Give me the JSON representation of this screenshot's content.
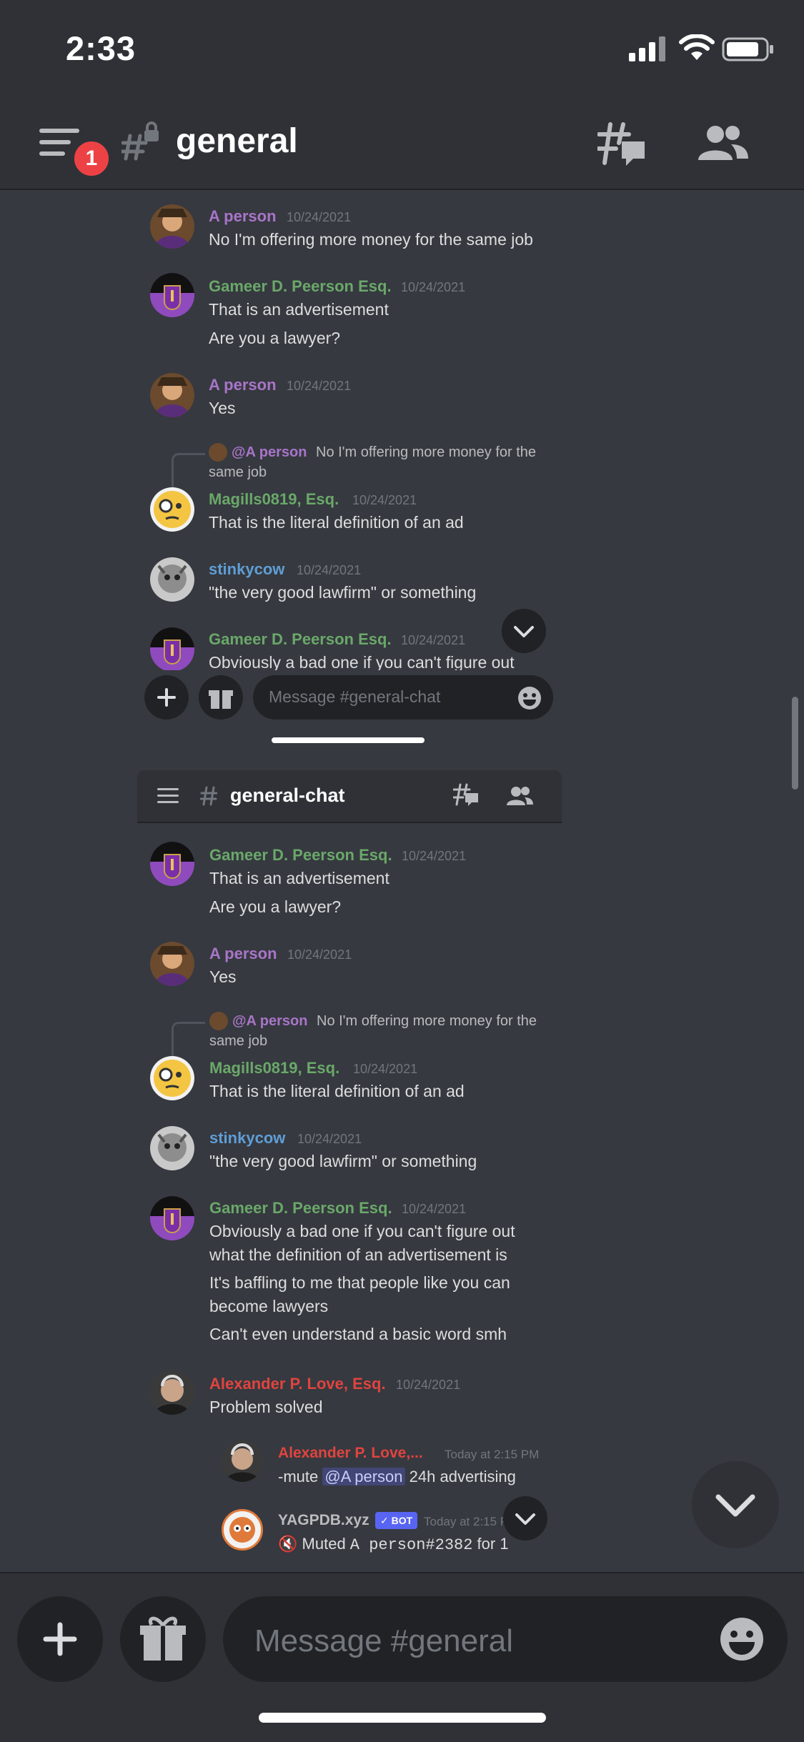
{
  "status_bar": {
    "time": "2:33"
  },
  "header": {
    "channel": "general",
    "notification_count": "1"
  },
  "shot1": {
    "messages": [
      {
        "author": "A person",
        "color": "#a875c9",
        "timestamp": "10/24/2021",
        "lines": [
          "No I'm offering more money for the same job"
        ]
      },
      {
        "author": "Gameer D. Peerson Esq.",
        "color": "#6aa86a",
        "timestamp": "10/24/2021",
        "lines": [
          "That is an advertisement",
          "Are you a lawyer?"
        ]
      },
      {
        "author": "A person",
        "color": "#a875c9",
        "timestamp": "10/24/2021",
        "lines": [
          "Yes"
        ]
      },
      {
        "reply_to": "@A person",
        "reply_text": "No I'm offering more money for the",
        "reply_text2": "same job",
        "author": "Magills0819, Esq.",
        "color": "#6aa86a",
        "timestamp": "10/24/2021",
        "lines": [
          "That is the literal definition of an ad"
        ]
      },
      {
        "author": "stinkycow",
        "color": "#5f9ed6",
        "timestamp": "10/24/2021",
        "lines": [
          "\"the very good lawfirm\" or something"
        ]
      },
      {
        "author": "Gameer D. Peerson Esq.",
        "color": "#6aa86a",
        "timestamp": "10/24/2021",
        "lines": [
          "Obviously a bad one if you can't figure out"
        ]
      }
    ],
    "input_placeholder": "Message #general-chat"
  },
  "shot2": {
    "channel": "general-chat",
    "messages": [
      {
        "author": "Gameer D. Peerson Esq.",
        "color": "#6aa86a",
        "timestamp": "10/24/2021",
        "lines": [
          "That is an advertisement",
          "Are you a lawyer?"
        ]
      },
      {
        "author": "A person",
        "color": "#a875c9",
        "timestamp": "10/24/2021",
        "lines": [
          "Yes"
        ]
      },
      {
        "reply_to": "@A person",
        "reply_text": "No I'm offering more money for the",
        "reply_text2": "same job",
        "author": "Magills0819, Esq.",
        "color": "#6aa86a",
        "timestamp": "10/24/2021",
        "lines": [
          "That is the literal definition of an ad"
        ]
      },
      {
        "author": "stinkycow",
        "color": "#5f9ed6",
        "timestamp": "10/24/2021",
        "lines": [
          "\"the very good lawfirm\" or something"
        ]
      },
      {
        "author": "Gameer D. Peerson Esq.",
        "color": "#6aa86a",
        "timestamp": "10/24/2021",
        "lines": [
          "Obviously a bad one if you can't figure out",
          "what the definition of an advertisement is",
          "It's baffling to me that people like you can",
          "become lawyers",
          "Can't even understand a basic word smh"
        ]
      },
      {
        "author": "Alexander P. Love, Esq.",
        "color": "#e0443f",
        "timestamp": "10/24/2021",
        "lines": [
          "Problem solved"
        ]
      }
    ],
    "thread": [
      {
        "author": "Alexander P. Love,...",
        "color": "#e0443f",
        "timestamp": "Today at 2:15 PM",
        "pre": "-mute ",
        "mention": "@A person",
        "post": " 24h advertising"
      },
      {
        "author": "YAGPDB.xyz",
        "color": "#b9bbbe",
        "bot_tag": "BOT",
        "timestamp": "Today at 2:15 P",
        "text": "Muted ",
        "code": "A person#2382",
        "text2": " for 1"
      }
    ]
  },
  "bottom": {
    "input_placeholder": "Message #general"
  },
  "icons": [
    "menu-icon",
    "hash-lock-icon",
    "threads-icon",
    "members-icon",
    "plus-icon",
    "gift-icon",
    "emoji-icon",
    "chevron-down-icon"
  ]
}
